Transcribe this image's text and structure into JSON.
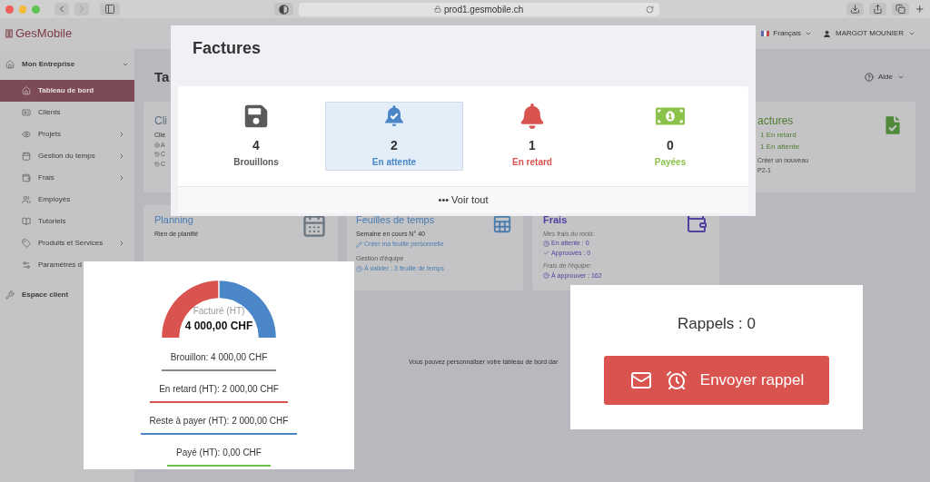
{
  "browser": {
    "url": "prod1.gesmobile.ch"
  },
  "app": {
    "logo": "GesMobile",
    "language": "Français",
    "user": "MARGOT MOUNIER"
  },
  "sidebar": {
    "groups": [
      {
        "label": "Mon Entreprise",
        "expanded": true,
        "children": [
          {
            "label": "Tableau de bord",
            "selected": true,
            "submenu": false
          },
          {
            "label": "Clients",
            "selected": false,
            "submenu": false
          },
          {
            "label": "Projets",
            "selected": false,
            "submenu": true
          },
          {
            "label": "Gestion du temps",
            "selected": false,
            "submenu": true
          },
          {
            "label": "Frais",
            "selected": false,
            "submenu": true
          },
          {
            "label": "Employés",
            "selected": false,
            "submenu": false
          },
          {
            "label": "Tutoriels",
            "selected": false,
            "submenu": false
          },
          {
            "label": "Produits et Services",
            "selected": false,
            "submenu": true
          },
          {
            "label": "Paramètres d",
            "selected": false
          }
        ]
      },
      {
        "label": "Espace client"
      }
    ]
  },
  "page": {
    "title": "Ta",
    "help": "Aide"
  },
  "clients_card": {
    "title": "Cli",
    "line": "Clie",
    "links": [
      "A",
      "C",
      "C"
    ]
  },
  "invoices_card": {
    "title": "actures",
    "status_lines": [
      "1 En retard",
      "1 En attente"
    ],
    "notes": [
      "Créer un nouveau",
      "P2-1"
    ]
  },
  "planning_card": {
    "title": "Planning",
    "text": "Rien de planifié"
  },
  "timesheets_card": {
    "title": "Feuilles de temps",
    "week": "Semaine en cours N° 40",
    "create_link": "Créer ma feuille personnelle",
    "team_label": "Gestion d'équipe",
    "validate_link": "À valider : 3 feuille de temps"
  },
  "expenses_card": {
    "title": "Frais",
    "my_label": "Mes frais du mois:",
    "pending": "En attente : 0",
    "approved": "Approuvés : 0",
    "team_label": "Frais de l'équipe:",
    "to_approve": "À approuver : 162"
  },
  "footer_text": "Vous pouvez personnaliser votre tableau de bord dar",
  "invoices_modal": {
    "title": "Factures",
    "stats": [
      {
        "kind": "draft",
        "count": "4",
        "label": "Brouillons",
        "selected": false,
        "color": "#5a5a5a"
      },
      {
        "kind": "pending",
        "count": "2",
        "label": "En attente",
        "selected": true,
        "color": "#4a86c8"
      },
      {
        "kind": "late",
        "count": "1",
        "label": "En retard",
        "selected": false,
        "color": "#d9534f"
      },
      {
        "kind": "paid",
        "count": "0",
        "label": "Payées",
        "selected": false,
        "color": "#8bc34a"
      }
    ],
    "more_icon": "•••",
    "more": "Voir tout"
  },
  "billing_panel": {
    "center_label": "Facturé (HT)",
    "total": "4 000,00 CHF",
    "lines": [
      {
        "text": "Brouillon: 4 000,00 CHF",
        "color": "#888888"
      },
      {
        "text": "En retard (HT): 2 000,00 CHF",
        "color": "#d9534f"
      },
      {
        "text": "Reste à payer (HT): 2 000,00 CHF",
        "color": "#4a86c8"
      },
      {
        "text": "Payé (HT): 0,00 CHF",
        "color": "#6cc04a"
      }
    ]
  },
  "reminders_panel": {
    "title": "Rappels : 0",
    "button": "Envoyer rappel"
  }
}
